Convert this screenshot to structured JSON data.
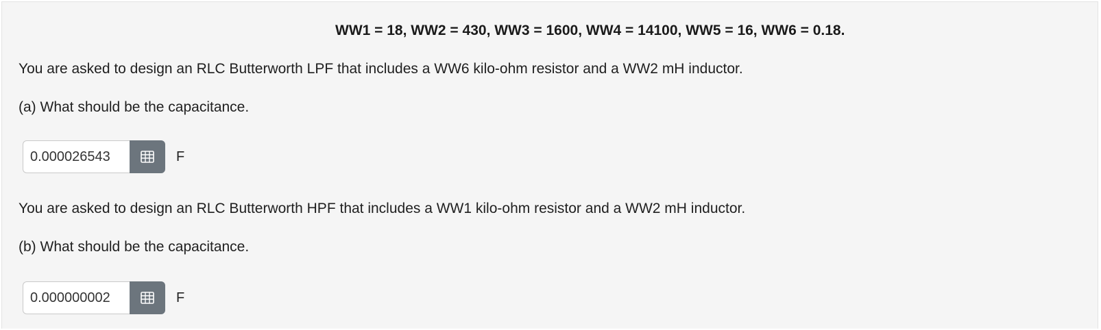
{
  "header": {
    "parameters": "WW1 = 18, WW2 = 430, WW3 = 1600, WW4 = 14100, WW5 = 16, WW6 = 0.18."
  },
  "part_a": {
    "prompt": "You are asked to design an RLC Butterworth LPF that includes a WW6 kilo-ohm resistor and a WW2 mH inductor.",
    "question": "(a) What should be the capacitance.",
    "answer_value": "0.000026543",
    "unit": "F",
    "button_icon": "calculator-icon"
  },
  "part_b": {
    "prompt": "You are asked to design an RLC Butterworth HPF that includes a WW1 kilo-ohm resistor and a WW2 mH inductor.",
    "question": "(b) What should be the capacitance.",
    "answer_value": "0.000000002",
    "unit": "F",
    "button_icon": "calculator-icon"
  },
  "colors": {
    "panel_background": "#f5f5f5",
    "button_background": "#6c757d"
  }
}
